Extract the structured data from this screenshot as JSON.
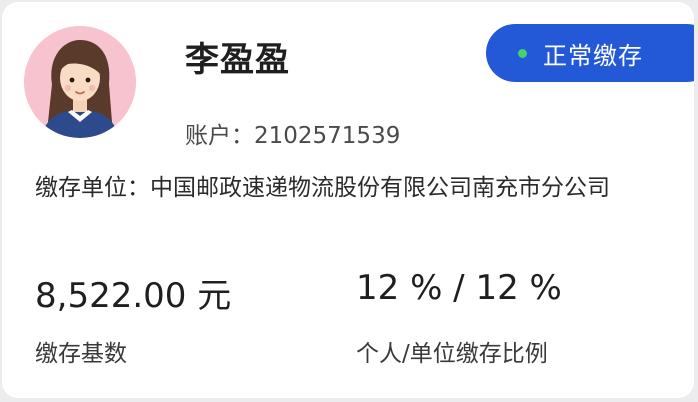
{
  "profile": {
    "name": "李盈盈",
    "account_label": "账户：",
    "account_number": "2102571539",
    "avatar_icon": "female-user-avatar-icon"
  },
  "status": {
    "label": "正常缴存",
    "dot_color": "#43d26b",
    "badge_color": "#2358d6"
  },
  "employer": {
    "label": "缴存单位：",
    "value": "中国邮政速递物流股份有限公司南充市分公司"
  },
  "stats": {
    "base_value": "8,522.00 元",
    "base_label": "缴存基数",
    "ratio_value": "12 % / 12 %",
    "ratio_label": "个人/单位缴存比例"
  }
}
